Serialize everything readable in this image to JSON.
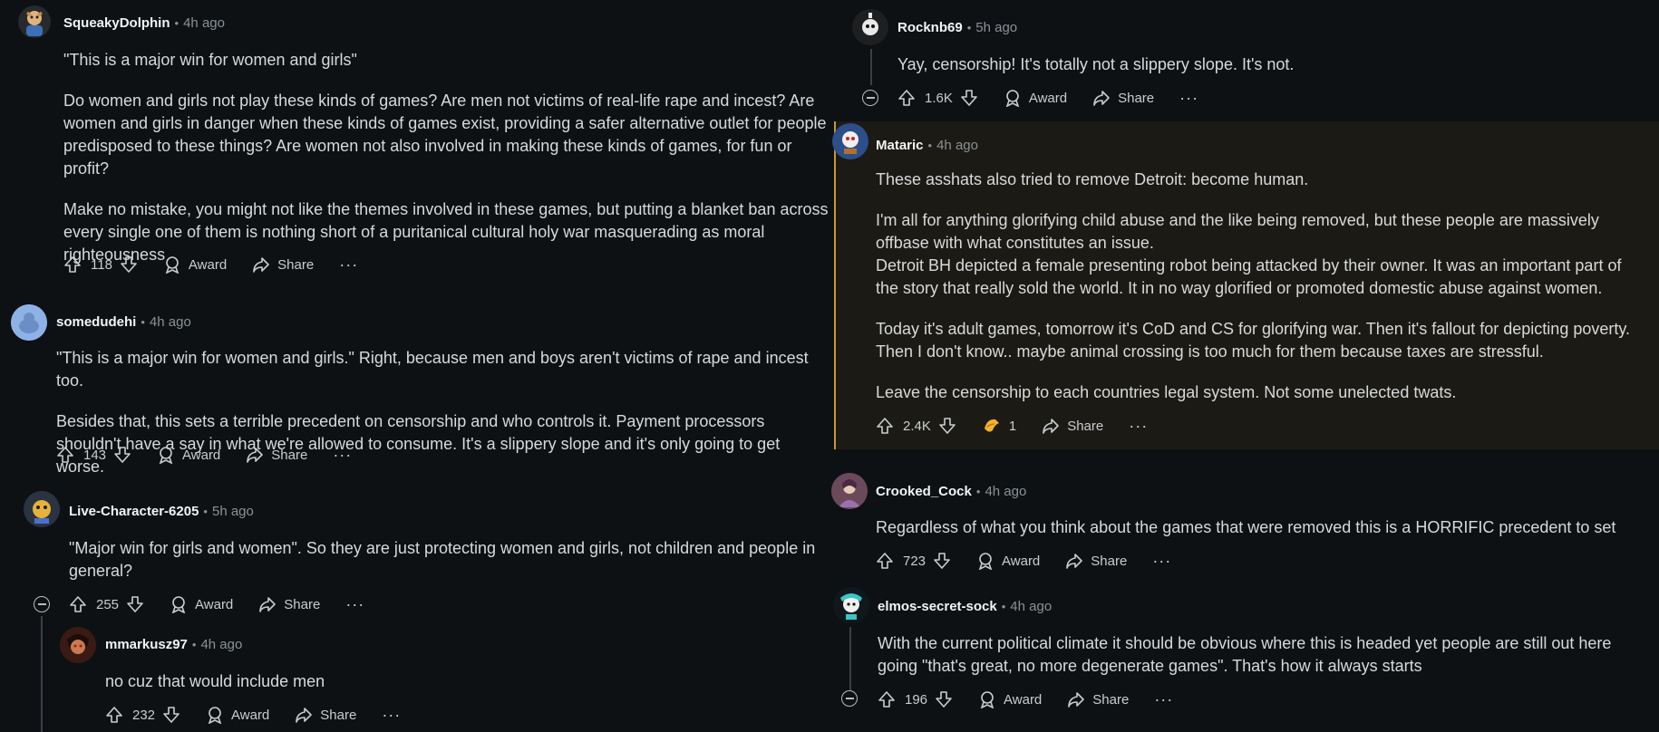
{
  "comments": {
    "c1": {
      "user": "SqueakyDolphin",
      "time": "4h ago",
      "paragraphs": [
        "\"This is a major win for women and girls\"",
        "Do women and girls not play these kinds of games? Are men not victims of real-life rape and incest? Are women and girls in danger when these kinds of games exist, providing a safer alternative outlet for people predisposed to these things? Are women not also involved in making these kinds of games, for fun or profit?",
        "Make no mistake, you might not like the themes involved in these games, but putting a blanket ban across every single one of them is nothing short of a puritanical cultural holy war masquerading as moral righteousness"
      ],
      "votes": "118",
      "award": "Award",
      "share": "Share",
      "more": "···"
    },
    "c2": {
      "user": "somedudehi",
      "time": "4h ago",
      "paragraphs": [
        "\"This is a major win for women and girls.\" Right, because men and boys aren't victims of rape and incest too.",
        "Besides that, this sets a terrible precedent on censorship and who controls it. Payment processors shouldn't have a say in what we're allowed to consume. It's a slippery slope and it's only going to get worse."
      ],
      "votes": "143",
      "award": "Award",
      "share": "Share",
      "more": "···"
    },
    "c3": {
      "user": "Live-Character-6205",
      "time": "5h ago",
      "paragraphs": [
        "\"Major win for girls and women\". So they are just protecting women and girls, not children and people in general?"
      ],
      "votes": "255",
      "award": "Award",
      "share": "Share",
      "more": "···"
    },
    "c4": {
      "user": "mmarkusz97",
      "time": "4h ago",
      "paragraphs": [
        "no cuz that would include men"
      ],
      "votes": "232",
      "award": "Award",
      "share": "Share",
      "more": "···"
    },
    "c5": {
      "user": "Rocknb69",
      "time": "5h ago",
      "paragraphs": [
        "Yay, censorship! It's totally not a slippery slope. It's not."
      ],
      "votes": "1.6K",
      "award": "Award",
      "share": "Share",
      "more": "···"
    },
    "c6": {
      "user": "Mataric",
      "time": "4h ago",
      "paragraphs": [
        "These asshats also tried to remove Detroit: become human.",
        "I'm all for anything glorifying child abuse and the like being removed, but these people are massively offbase with what constitutes an issue.",
        "Detroit BH depicted a female presenting robot being attacked by their owner. It was an important part of the story that really sold the world. It in no way glorified or promoted domestic abuse against women.",
        "Today it's adult games, tomorrow it's CoD and CS for glorifying war. Then it's fallout for depicting poverty. Then I don't know.. maybe animal crossing is too much for them because taxes are stressful.",
        "Leave the censorship to each countries legal system. Not some unelected twats."
      ],
      "votes": "2.4K",
      "award_count": "1",
      "share": "Share",
      "more": "···"
    },
    "c7": {
      "user": "Crooked_Cock",
      "time": "4h ago",
      "paragraphs": [
        "Regardless of what you think about the games that were removed this is a HORRIFIC precedent to set"
      ],
      "votes": "723",
      "award": "Award",
      "share": "Share",
      "more": "···"
    },
    "c8": {
      "user": "elmos-secret-sock",
      "time": "4h ago",
      "paragraphs": [
        "With the current political climate it should be obvious where this is headed yet people are still out here going \"that's great, no more degenerate games\". That's how it always starts"
      ],
      "votes": "196",
      "award": "Award",
      "share": "Share",
      "more": "···"
    }
  },
  "separator": "•",
  "colors": {
    "background": "#0e1113",
    "highlight": "#1c1a14",
    "highlight_border": "#c79a2c",
    "text": "#d7dadc",
    "muted": "#8b9196"
  },
  "icons": [
    "upvote-icon",
    "downvote-icon",
    "award-icon",
    "share-icon",
    "collapse-icon",
    "award-emoji-icon"
  ]
}
